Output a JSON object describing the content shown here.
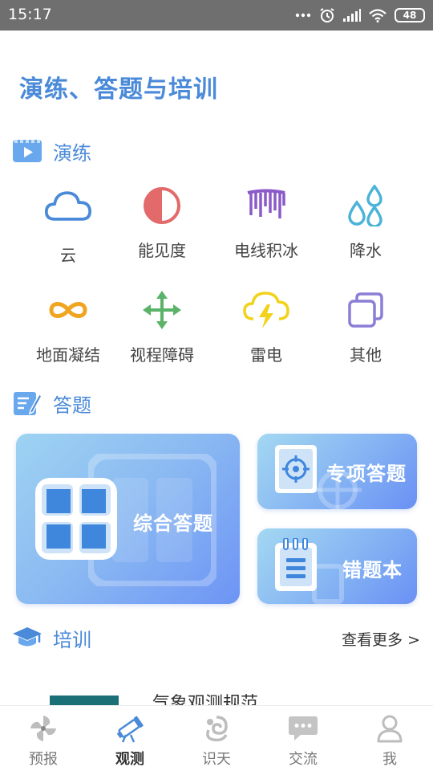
{
  "status_bar": {
    "time": "15:17",
    "battery": "48"
  },
  "page_title": "演练、答题与培训",
  "drill": {
    "title": "演练",
    "items": [
      {
        "label": "云",
        "icon": "cloud-icon"
      },
      {
        "label": "能见度",
        "icon": "visibility-icon"
      },
      {
        "label": "电线积冰",
        "icon": "wire-icing-icon"
      },
      {
        "label": "降水",
        "icon": "precipitation-icon"
      },
      {
        "label": "地面凝结",
        "icon": "ground-condensation-icon"
      },
      {
        "label": "视程障碍",
        "icon": "visual-obstruction-icon"
      },
      {
        "label": "雷电",
        "icon": "thunder-icon"
      },
      {
        "label": "其他",
        "icon": "other-icon"
      }
    ]
  },
  "quiz": {
    "title": "答题",
    "comprehensive": "综合答题",
    "special": "专项答题",
    "wrong_book": "错题本"
  },
  "training": {
    "title": "培训",
    "more": "查看更多 >",
    "course_title": "气象观测规范"
  },
  "nav": {
    "items": [
      {
        "label": "预报",
        "icon": "forecast-icon"
      },
      {
        "label": "观测",
        "icon": "observation-icon"
      },
      {
        "label": "识天",
        "icon": "sky-knowledge-icon"
      },
      {
        "label": "交流",
        "icon": "chat-icon"
      },
      {
        "label": "我",
        "icon": "profile-icon"
      }
    ],
    "active": "观测"
  },
  "colors": {
    "accent": "#4a8ad8",
    "status_bar": "#6f6f6f",
    "card_gradient_start": "#9ed3f2",
    "card_gradient_end": "#6d94f5"
  }
}
